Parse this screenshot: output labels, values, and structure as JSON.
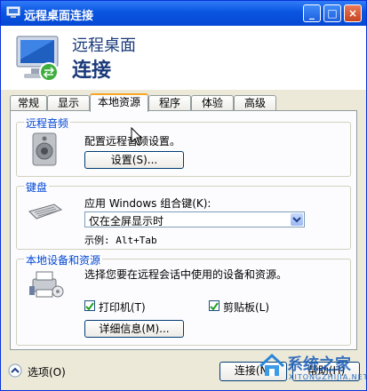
{
  "window": {
    "title": "远程桌面连接"
  },
  "header": {
    "line1": "远程桌面",
    "line2": "连接"
  },
  "tabs": [
    {
      "label": "常规"
    },
    {
      "label": "显示"
    },
    {
      "label": "本地资源"
    },
    {
      "label": "程序"
    },
    {
      "label": "体验"
    },
    {
      "label": "高级"
    }
  ],
  "audio": {
    "group_label": "远程音频",
    "description": "配置远程音频设置。",
    "settings_button": "设置(S)..."
  },
  "keyboard": {
    "group_label": "键盘",
    "apply_label": "应用 Windows 组合键(K):",
    "selected_option": "仅在全屏显示时",
    "example": "示例: Alt+Tab"
  },
  "devices": {
    "group_label": "本地设备和资源",
    "description": "选择您要在远程会话中使用的设备和资源。",
    "printers_label": "打印机(T)",
    "clipboard_label": "剪贴板(L)",
    "details_button": "详细信息(M)..."
  },
  "footer": {
    "options_label": "选项(O)",
    "connect_button": "连接(N)",
    "help_button": "帮助(H)"
  },
  "watermark": {
    "text": "系统之家",
    "subtext": "XITONGZHIJIA.NET"
  }
}
